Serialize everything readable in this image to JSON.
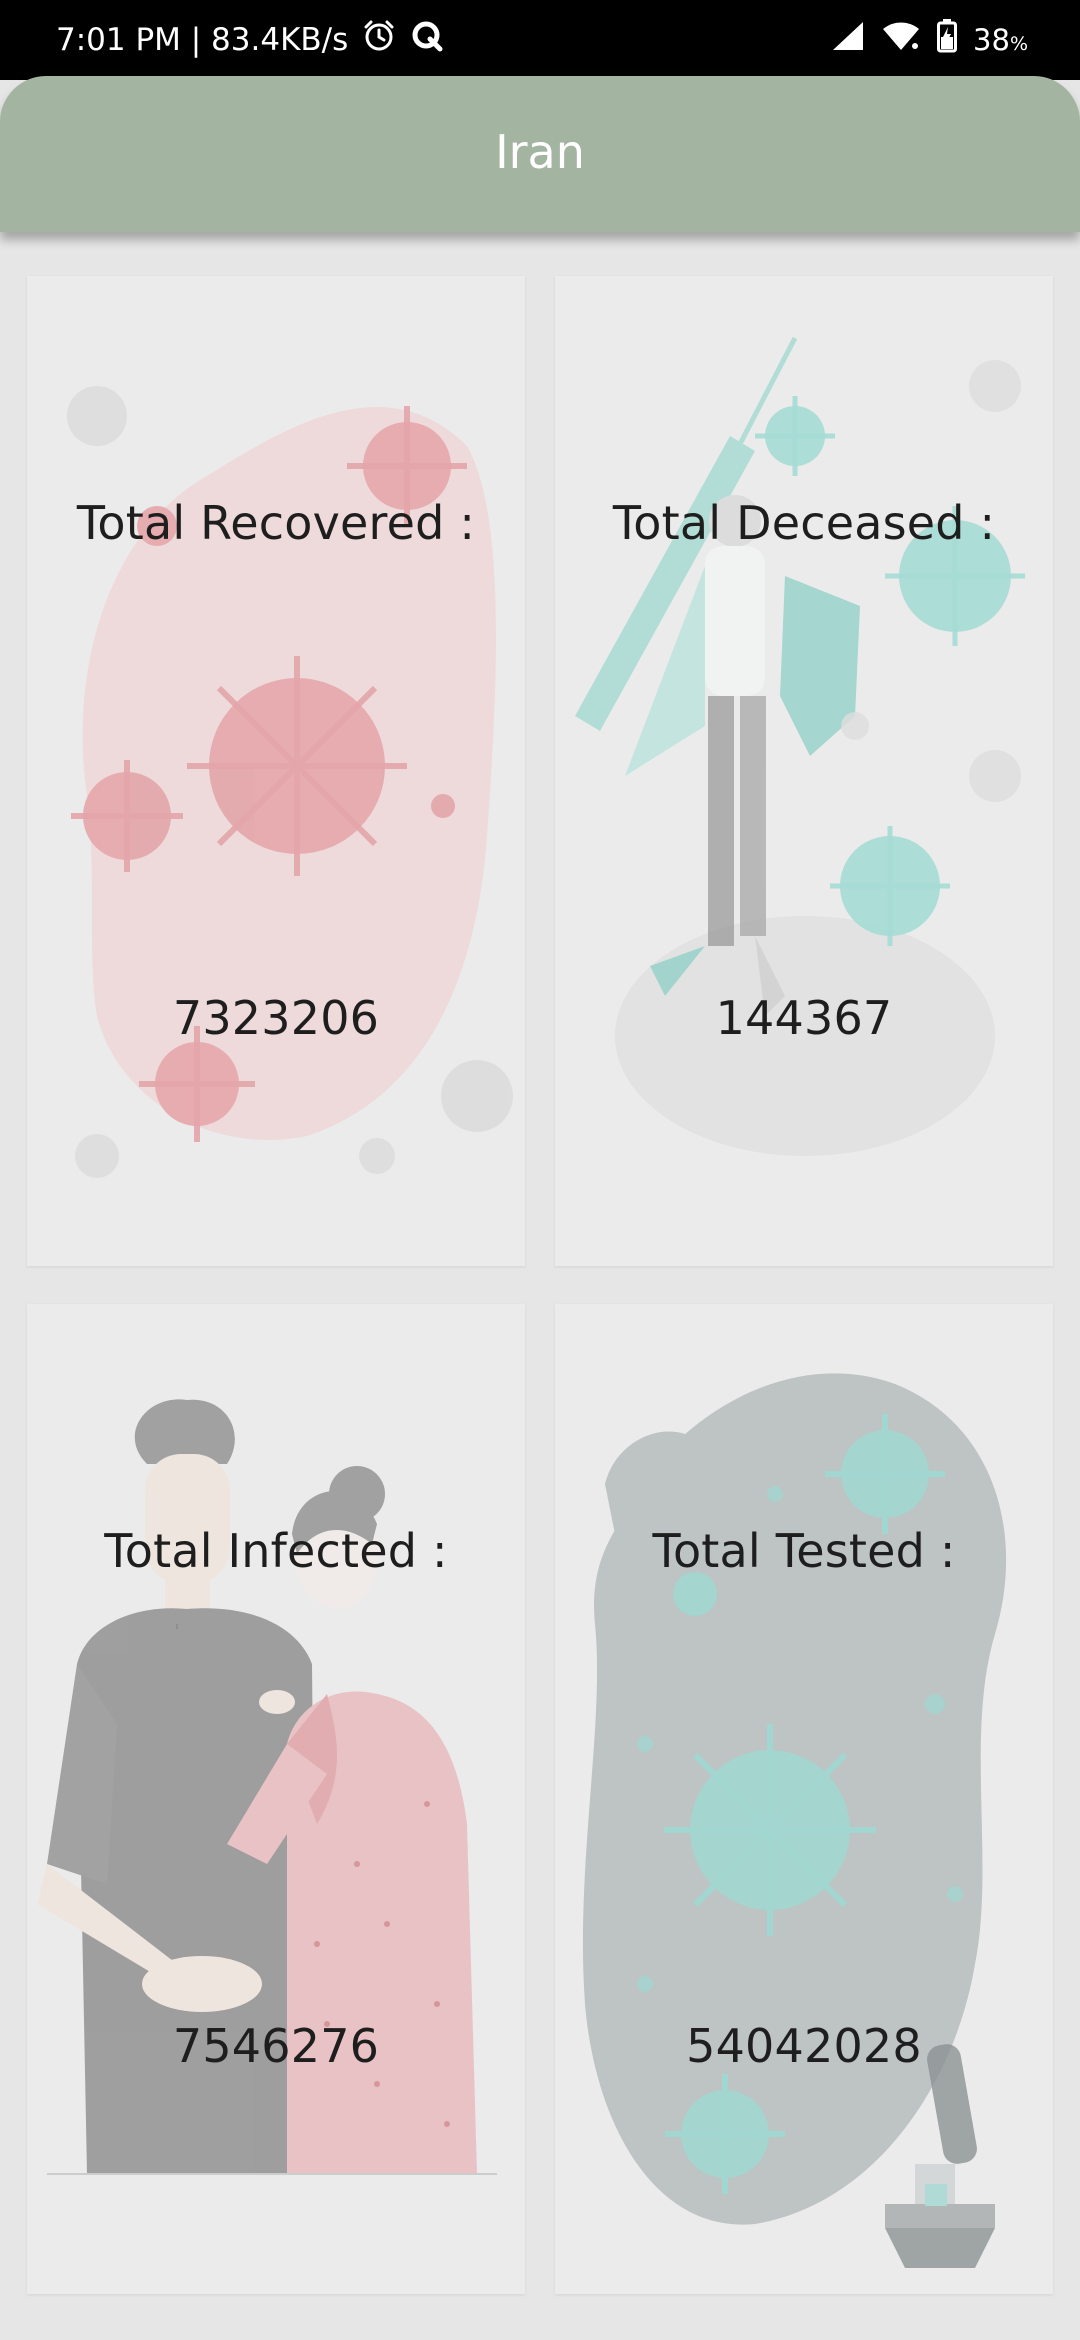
{
  "status_bar": {
    "time_speed": "7:01 PM | 83.4KB/s",
    "battery_percent": "38",
    "battery_unit": "%",
    "icons": [
      "alarm-icon",
      "q-app-icon",
      "signal-icon",
      "wifi-icon",
      "battery-icon"
    ]
  },
  "app_bar": {
    "title": "Iran",
    "color": "#a3b5a1"
  },
  "cards": [
    {
      "label": "Total Recovered :",
      "value": "7323206",
      "illustration": "red-virus-illustration"
    },
    {
      "label": "Total Deceased :",
      "value": "144367",
      "illustration": "doctor-with-syringe-illustration"
    },
    {
      "label": "Total Infected :",
      "value": "7546276",
      "illustration": "coughing-people-illustration"
    },
    {
      "label": "Total Tested :",
      "value": "54042028",
      "illustration": "virus-blob-microscope-illustration"
    }
  ]
}
